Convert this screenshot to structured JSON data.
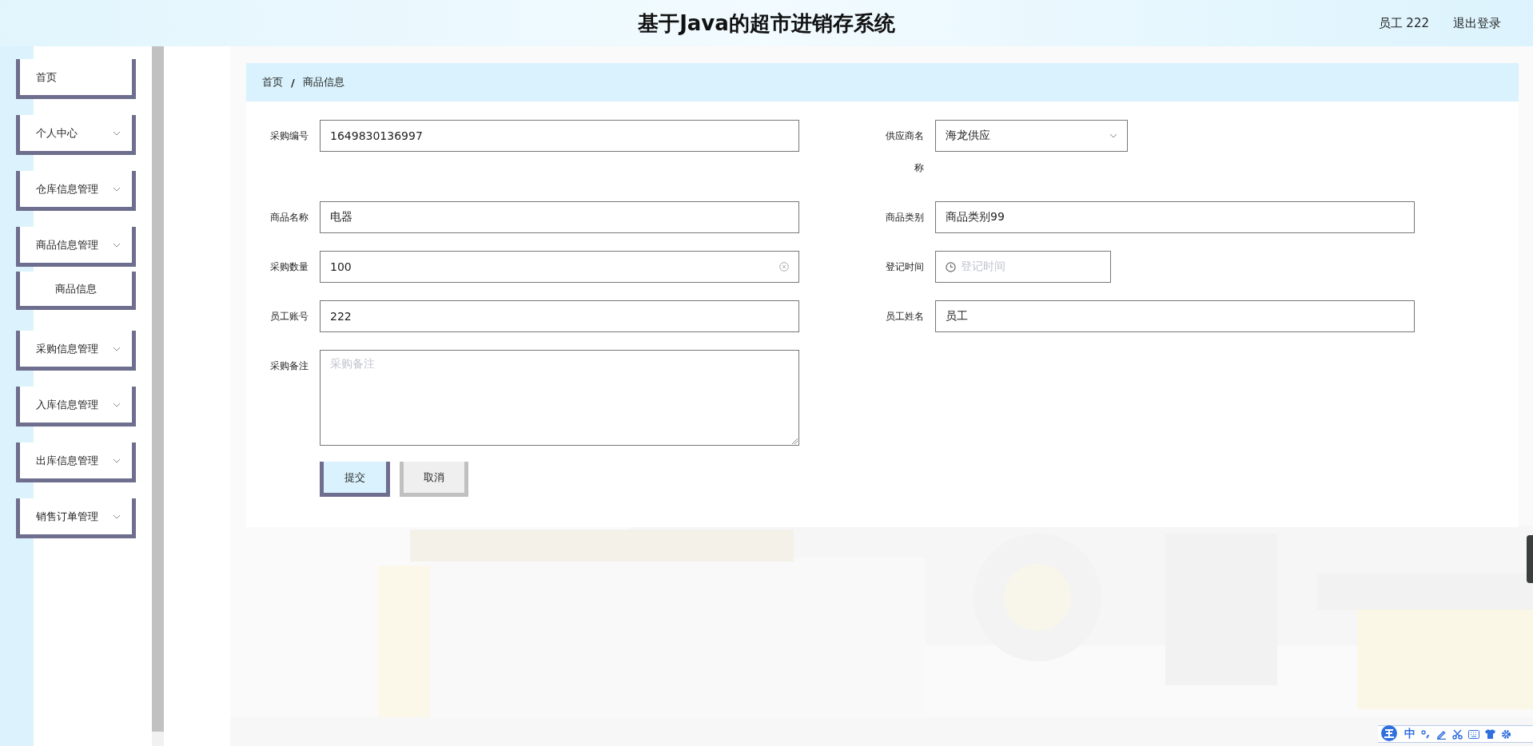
{
  "header": {
    "title": "基于Java的超市进销存系统",
    "user": "员工 222",
    "logout": "退出登录"
  },
  "sidebar": {
    "items": [
      {
        "label": "首页",
        "kind": "link"
      },
      {
        "label": "个人中心",
        "kind": "submenu"
      },
      {
        "label": "仓库信息管理",
        "kind": "submenu"
      },
      {
        "label": "商品信息管理",
        "kind": "submenu",
        "children": [
          {
            "label": "商品信息"
          }
        ]
      },
      {
        "label": "采购信息管理",
        "kind": "submenu"
      },
      {
        "label": "入库信息管理",
        "kind": "submenu"
      },
      {
        "label": "出库信息管理",
        "kind": "submenu"
      },
      {
        "label": "销售订单管理",
        "kind": "submenu"
      }
    ]
  },
  "breadcrumb": {
    "items": [
      "首页",
      "商品信息"
    ],
    "separator": "/"
  },
  "form": {
    "rows": [
      [
        {
          "label": "采购编号",
          "kind": "text",
          "value": "1649830136997"
        },
        {
          "label": "供应商名称",
          "kind": "select",
          "value": "海龙供应"
        }
      ],
      [
        {
          "label": "商品名称",
          "kind": "text",
          "value": "电器"
        },
        {
          "label": "商品类别",
          "kind": "text",
          "value": "商品类别99"
        }
      ],
      [
        {
          "label": "采购数量",
          "kind": "text",
          "value": "100",
          "clearable": true
        },
        {
          "label": "登记时间",
          "kind": "date",
          "placeholder": "登记时间"
        }
      ],
      [
        {
          "label": "员工账号",
          "kind": "text",
          "value": "222"
        },
        {
          "label": "员工姓名",
          "kind": "text",
          "value": "员工"
        }
      ],
      [
        {
          "label": "采购备注",
          "kind": "textarea",
          "placeholder": "采购备注"
        }
      ]
    ],
    "buttons": [
      {
        "label": "提交",
        "kind": "primary"
      },
      {
        "label": "取消",
        "kind": "default"
      }
    ]
  },
  "ime_toolbar": {
    "label": "中"
  }
}
